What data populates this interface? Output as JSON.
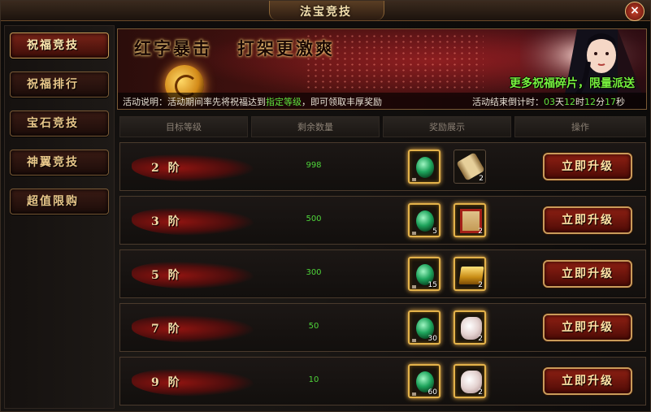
{
  "window": {
    "title": "法宝竞技",
    "close_label": "×"
  },
  "sidebar": {
    "items": [
      {
        "label": "祝福竞技",
        "active": true
      },
      {
        "label": "祝福排行",
        "active": false
      },
      {
        "label": "宝石竞技",
        "active": false
      },
      {
        "label": "神翼竞技",
        "active": false
      },
      {
        "label": "超值限购",
        "active": false
      }
    ]
  },
  "banner": {
    "title_left": "红字暴击",
    "title_right": "打架更激爽",
    "slogan": "更多祝福碎片，限量派送",
    "desc_label": "活动说明：",
    "desc_pre": "活动期间率先将祝福达到",
    "desc_highlight": "指定等级",
    "desc_post": "，即可领取丰厚奖励",
    "timer_label": "活动结束倒计时：",
    "timer_days": "03",
    "timer_days_unit": "天",
    "timer_hours": "12",
    "timer_hours_unit": "时",
    "timer_minutes": "12",
    "timer_minutes_unit": "分",
    "timer_seconds": "17",
    "timer_seconds_unit": "秒"
  },
  "table": {
    "headers": [
      "目标等级",
      "剩余数量",
      "奖励展示",
      "操作"
    ],
    "button_label": "立即升级",
    "rows": [
      {
        "level": "2 阶",
        "remaining": "998",
        "rewards": [
          {
            "icon": "gem-icon",
            "count": ""
          },
          {
            "icon": "scroll-icon",
            "count": "2"
          }
        ]
      },
      {
        "level": "3 阶",
        "remaining": "500",
        "rewards": [
          {
            "icon": "gem-icon",
            "count": "5"
          },
          {
            "icon": "red-book-icon",
            "count": "2"
          }
        ]
      },
      {
        "level": "5 阶",
        "remaining": "300",
        "rewards": [
          {
            "icon": "gem-icon",
            "count": "15"
          },
          {
            "icon": "gold-bar-icon",
            "count": "2"
          }
        ]
      },
      {
        "level": "7 阶",
        "remaining": "50",
        "rewards": [
          {
            "icon": "gem-icon",
            "count": "30"
          },
          {
            "icon": "cloth-icon",
            "count": "2"
          }
        ]
      },
      {
        "level": "9 阶",
        "remaining": "10",
        "rewards": [
          {
            "icon": "gem-icon",
            "count": "60"
          },
          {
            "icon": "cloth-icon",
            "count": "2"
          }
        ]
      }
    ]
  },
  "colors": {
    "accent_gold": "#e3b24a",
    "value_green": "#4fd63a",
    "slogan_green": "#77f13e",
    "button_red": "#8f2013"
  }
}
